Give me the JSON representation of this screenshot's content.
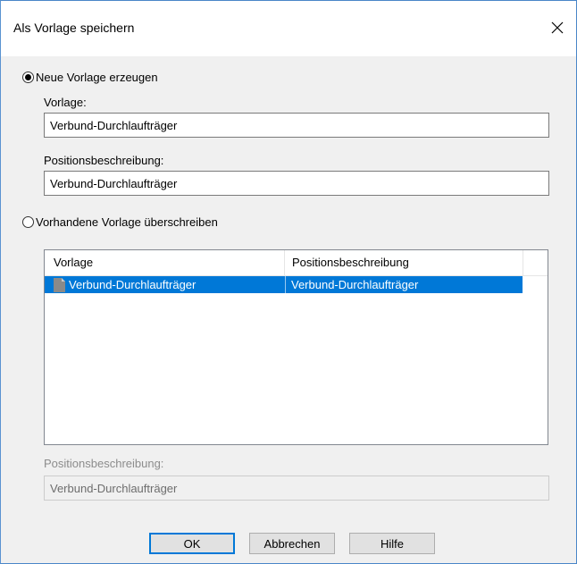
{
  "window": {
    "title": "Als Vorlage speichern",
    "close_icon": "close-icon"
  },
  "new_template": {
    "radio_label": "Neue Vorlage erzeugen",
    "checked": true,
    "template_label": "Vorlage:",
    "template_value": "Verbund-Durchlaufträger",
    "description_label": "Positionsbeschreibung:",
    "description_value": "Verbund-Durchlaufträger"
  },
  "overwrite_template": {
    "radio_label": "Vorhandene Vorlage überschreiben",
    "checked": false,
    "columns": [
      "Vorlage",
      "Positionsbeschreibung"
    ],
    "rows": [
      {
        "icon": "document-icon",
        "template": "Verbund-Durchlaufträger",
        "description": "Verbund-Durchlaufträger",
        "selected": true
      }
    ],
    "description_label": "Positionsbeschreibung:",
    "description_value": "Verbund-Durchlaufträger"
  },
  "buttons": {
    "ok": "OK",
    "cancel": "Abbrechen",
    "help": "Hilfe"
  },
  "colors": {
    "selection": "#0078d7",
    "dialog_background": "#f0f0f0",
    "border": "#4a86c8"
  }
}
